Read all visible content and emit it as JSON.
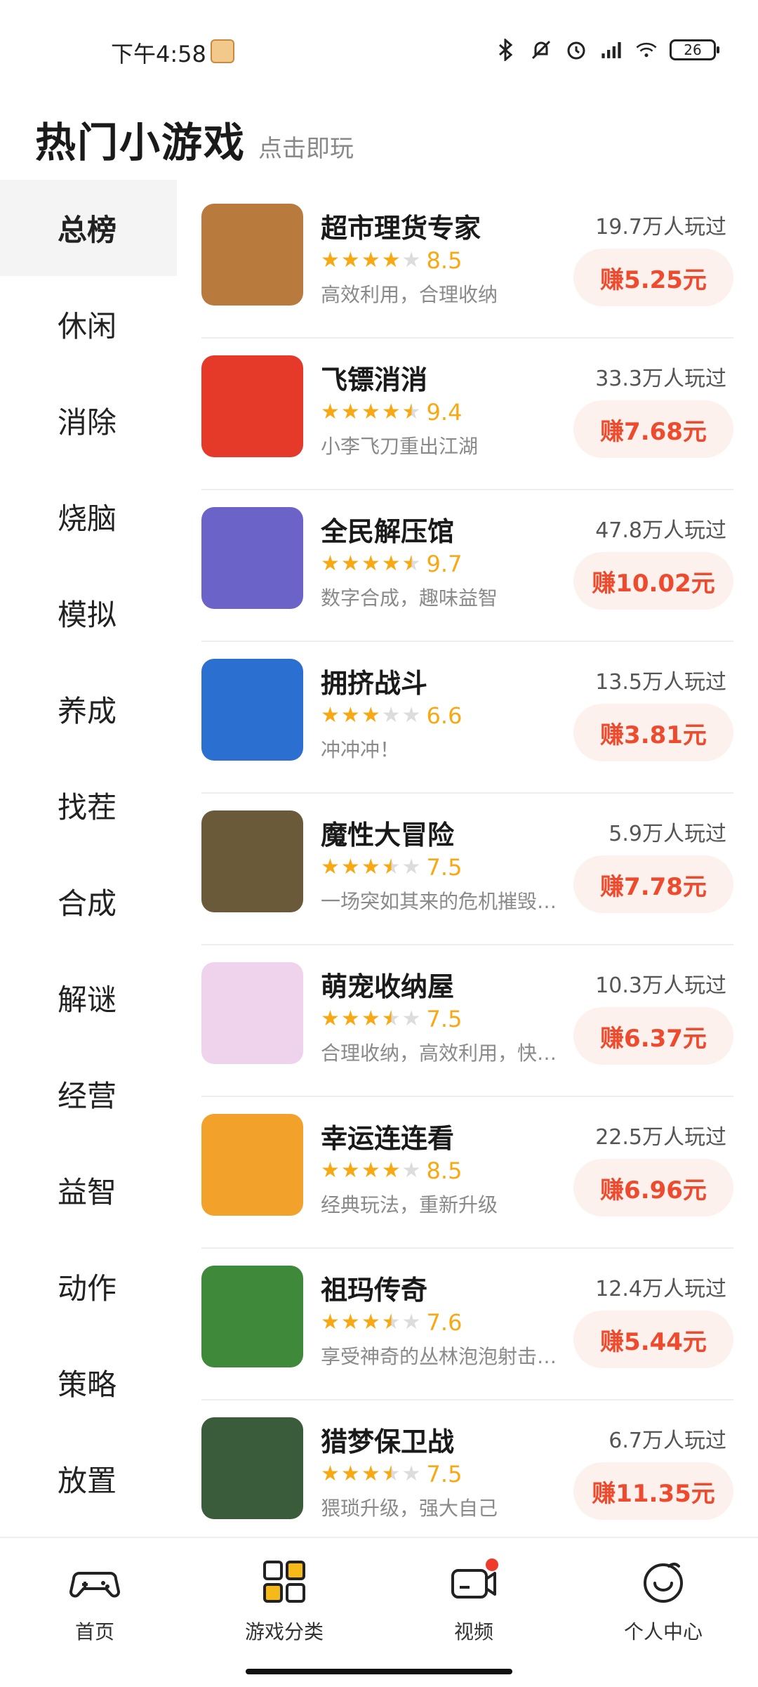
{
  "status_bar": {
    "time": "下午4:58",
    "battery": "26"
  },
  "header": {
    "title": "热门小游戏",
    "subtitle": "点击即玩"
  },
  "sidebar": {
    "items": [
      {
        "label": "总榜",
        "active": true
      },
      {
        "label": "休闲"
      },
      {
        "label": "消除"
      },
      {
        "label": "烧脑"
      },
      {
        "label": "模拟"
      },
      {
        "label": "养成"
      },
      {
        "label": "找茬"
      },
      {
        "label": "合成"
      },
      {
        "label": "解谜"
      },
      {
        "label": "经营"
      },
      {
        "label": "益智"
      },
      {
        "label": "动作"
      },
      {
        "label": "策略"
      },
      {
        "label": "放置"
      }
    ]
  },
  "games": [
    {
      "name": "超市理货专家",
      "rating": 4,
      "score": "8.5",
      "desc": "高效利用，合理收纳",
      "plays": "19.7万人玩过",
      "earn": "赚5.25元",
      "color": "#b97a3d"
    },
    {
      "name": "飞镖消消",
      "rating": 4.5,
      "score": "9.4",
      "desc": "小李飞刀重出江湖",
      "plays": "33.3万人玩过",
      "earn": "赚7.68元",
      "color": "#e53a2a"
    },
    {
      "name": "全民解压馆",
      "rating": 4.5,
      "score": "9.7",
      "desc": "数字合成，趣味益智",
      "plays": "47.8万人玩过",
      "earn": "赚10.02元",
      "color": "#6c63c9"
    },
    {
      "name": "拥挤战斗",
      "rating": 3,
      "score": "6.6",
      "desc": "冲冲冲！",
      "plays": "13.5万人玩过",
      "earn": "赚3.81元",
      "color": "#2b6fd1"
    },
    {
      "name": "魔性大冒险",
      "rating": 3.5,
      "score": "7.5",
      "desc": "一场突如其来的危机摧毁了...",
      "plays": "5.9万人玩过",
      "earn": "赚7.78元",
      "color": "#6a5a3a"
    },
    {
      "name": "萌宠收纳屋",
      "rating": 3.5,
      "score": "7.5",
      "desc": "合理收纳，高效利用，快来挑战",
      "plays": "10.3万人玩过",
      "earn": "赚6.37元",
      "color": "#efd2ec"
    },
    {
      "name": "幸运连连看",
      "rating": 4,
      "score": "8.5",
      "desc": "经典玩法，重新升级",
      "plays": "22.5万人玩过",
      "earn": "赚6.96元",
      "color": "#f2a12b"
    },
    {
      "name": "祖玛传奇",
      "rating": 3.5,
      "score": "7.6",
      "desc": "享受神奇的丛林泡泡射击游戏",
      "plays": "12.4万人玩过",
      "earn": "赚5.44元",
      "color": "#3f8a3a"
    },
    {
      "name": "猎梦保卫战",
      "rating": 3.5,
      "score": "7.5",
      "desc": "猥琐升级，强大自己",
      "plays": "6.7万人玩过",
      "earn": "赚11.35元",
      "color": "#3b5c3a"
    }
  ],
  "tabs": [
    {
      "label": "首页"
    },
    {
      "label": "游戏分类"
    },
    {
      "label": "视频"
    },
    {
      "label": "个人中心"
    }
  ]
}
